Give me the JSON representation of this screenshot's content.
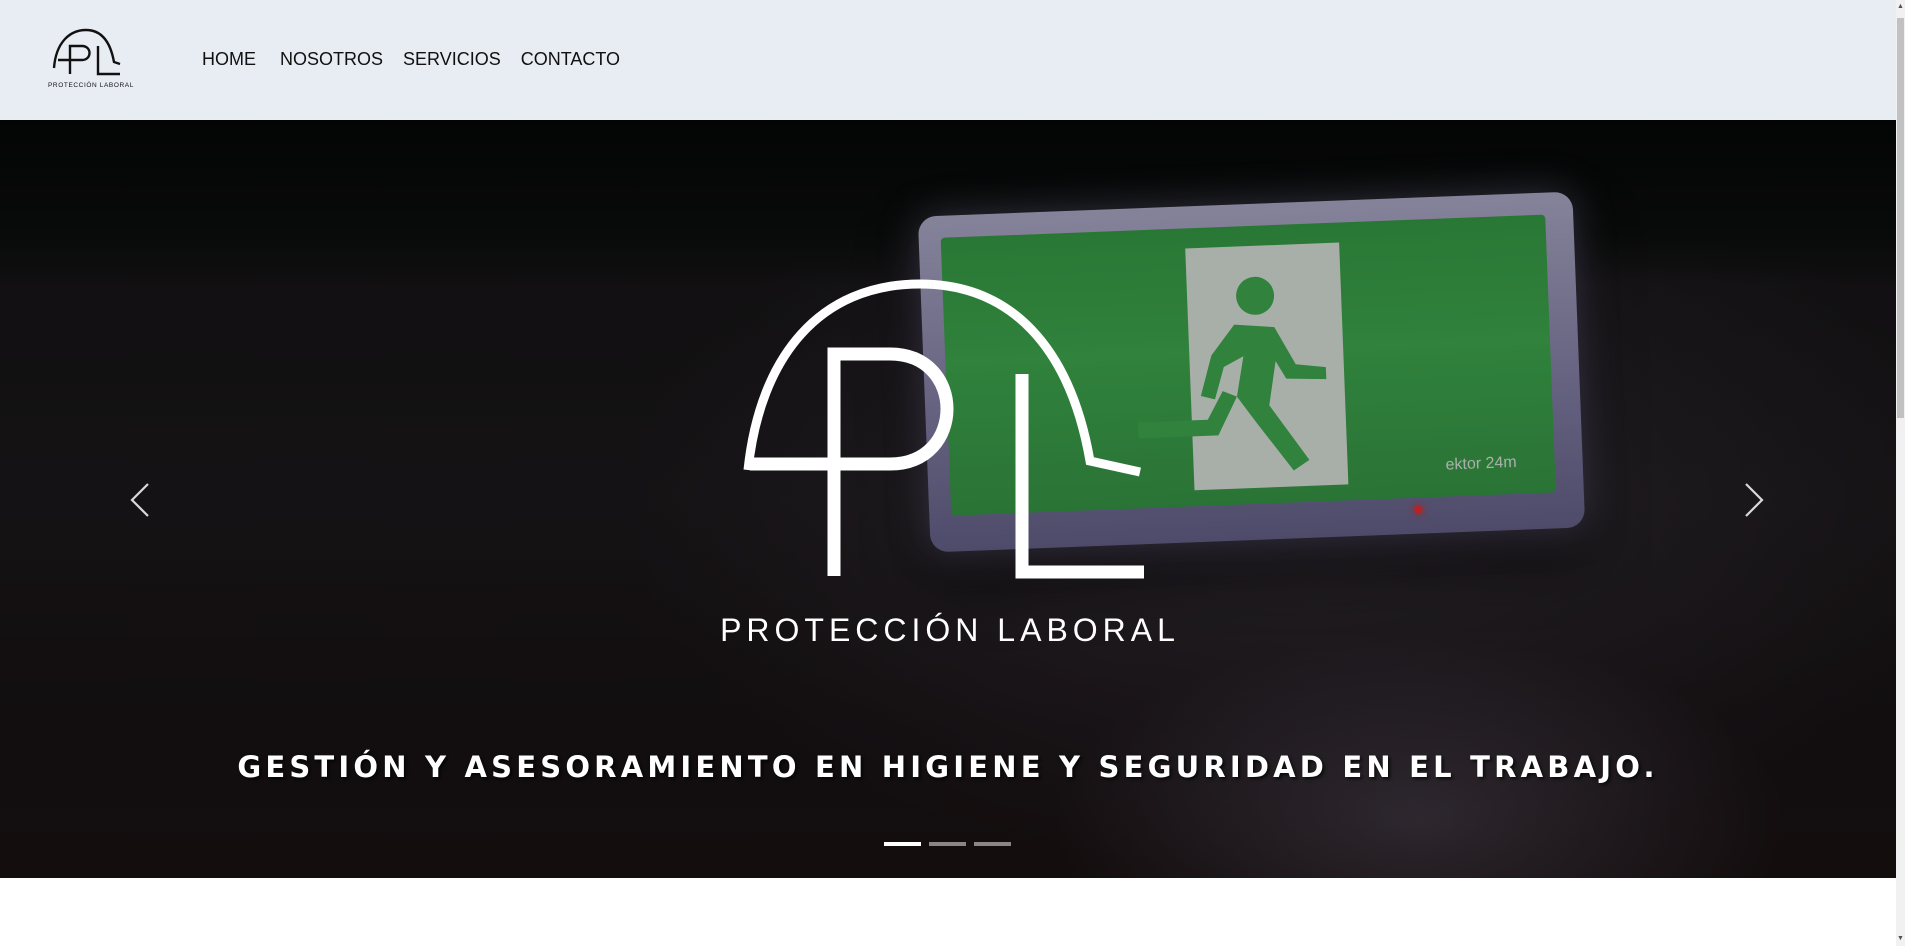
{
  "brand": {
    "monogram": "PL",
    "caption": "PROTECCIÓN LABORAL"
  },
  "nav": {
    "items": [
      "HOME",
      "NOSOTROS",
      "SERVICIOS",
      "CONTACTO"
    ]
  },
  "hero": {
    "logo_monogram": "PL",
    "logo_text": "PROTECCIÓN LABORAL",
    "tagline": "GESTIÓN Y ASESORAMIENTO EN HIGIENE Y SEGURIDAD EN EL TRABAJO.",
    "sign_brand": "ektor 24m",
    "prev_icon": "chevron-left-icon",
    "next_icon": "chevron-right-icon",
    "slides": 3,
    "active_slide": 1
  },
  "colors": {
    "header_bg": "#e8edf4",
    "sign_green": "#43b454",
    "text_white": "#ffffff"
  }
}
